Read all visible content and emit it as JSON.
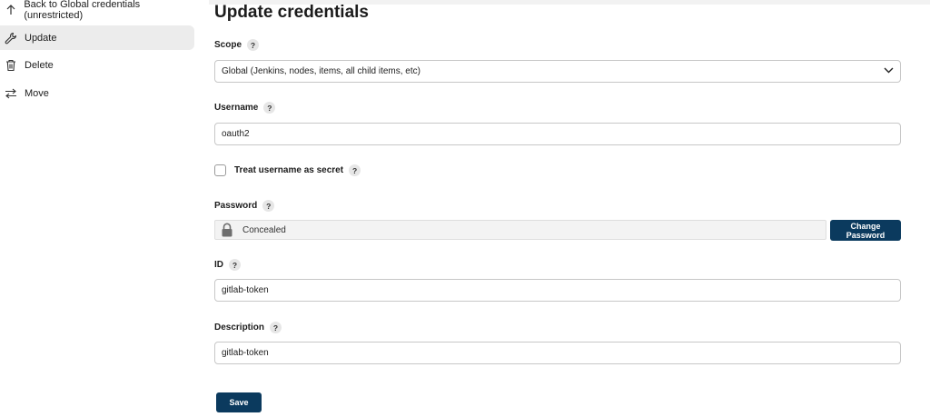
{
  "sidebar": {
    "items": [
      {
        "label": "Back to Global credentials (unrestricted)",
        "icon": "arrow-up-icon"
      },
      {
        "label": "Update",
        "icon": "wrench-icon",
        "active": true
      },
      {
        "label": "Delete",
        "icon": "trash-icon"
      },
      {
        "label": "Move",
        "icon": "swap-arrows-icon"
      }
    ]
  },
  "form": {
    "title": "Update credentials",
    "help_glyph": "?",
    "scope": {
      "label": "Scope",
      "value": "Global (Jenkins, nodes, items, all child items, etc)"
    },
    "username": {
      "label": "Username",
      "value": "oauth2"
    },
    "treat_secret": {
      "label": "Treat username as secret",
      "checked": false
    },
    "password": {
      "label": "Password",
      "value": "Concealed",
      "change_label": "Change Password"
    },
    "id": {
      "label": "ID",
      "value": "gitlab-token"
    },
    "description": {
      "label": "Description",
      "value": "gitlab-token"
    },
    "save_label": "Save"
  },
  "colors": {
    "primary_button": "#0b3a5e",
    "active_nav_bg": "#ececec",
    "border": "#c7c7c7"
  }
}
